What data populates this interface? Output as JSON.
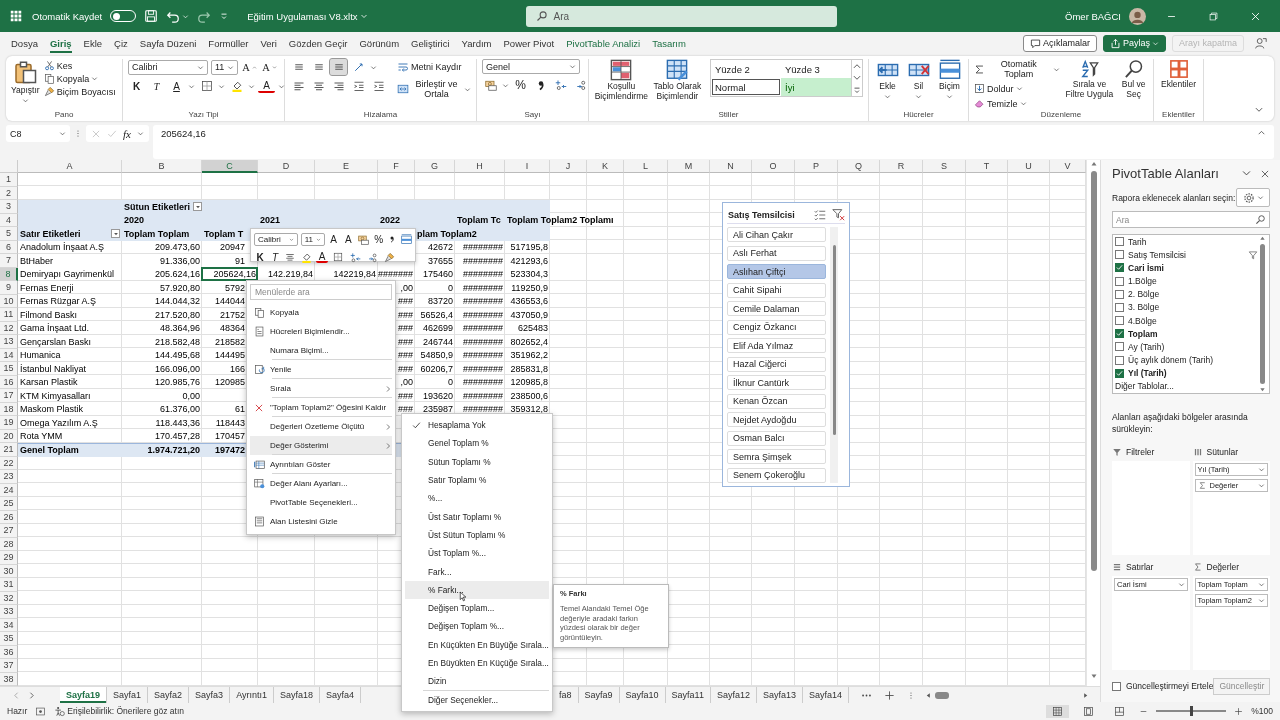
{
  "title_bar": {
    "autosave_label": "Otomatik Kaydet",
    "autosave_on": false,
    "file_name": "Eğitim Uygulaması V8.xltx",
    "search_placeholder": "Ara",
    "user_name": "Ömer BAĞCI"
  },
  "ribbon_tabs": [
    {
      "label": "Dosya",
      "selected": false,
      "kind": "normal"
    },
    {
      "label": "Giriş",
      "selected": true,
      "kind": "normal"
    },
    {
      "label": "Ekle",
      "selected": false,
      "kind": "normal"
    },
    {
      "label": "Çiz",
      "selected": false,
      "kind": "normal"
    },
    {
      "label": "Sayfa Düzeni",
      "selected": false,
      "kind": "normal"
    },
    {
      "label": "Formüller",
      "selected": false,
      "kind": "normal"
    },
    {
      "label": "Veri",
      "selected": false,
      "kind": "normal"
    },
    {
      "label": "Gözden Geçir",
      "selected": false,
      "kind": "normal"
    },
    {
      "label": "Görünüm",
      "selected": false,
      "kind": "normal"
    },
    {
      "label": "Geliştirici",
      "selected": false,
      "kind": "normal"
    },
    {
      "label": "Yardım",
      "selected": false,
      "kind": "normal"
    },
    {
      "label": "Power Pivot",
      "selected": false,
      "kind": "normal"
    },
    {
      "label": "PivotTable Analizi",
      "selected": false,
      "kind": "context"
    },
    {
      "label": "Tasarım",
      "selected": false,
      "kind": "context"
    }
  ],
  "ribbon_actions": {
    "comments": "Açıklamalar",
    "share": "Paylaş",
    "end_call": {
      "label": "Arayı kapatma",
      "disabled": true
    }
  },
  "ribbon": {
    "clipboard": {
      "paste": "Yapıştır",
      "cut": "Kes",
      "copy": "Kopyala",
      "format_painter": "Biçim Boyacısı",
      "label": "Pano"
    },
    "font": {
      "name": "Calibri",
      "size": "11",
      "grow": "A",
      "shrink": "A",
      "bold": "K",
      "italic": "T",
      "underline": "A",
      "font_color": "A",
      "label": "Yazı Tipi"
    },
    "alignment": {
      "vertical_align": [
        {
          "selected": false
        },
        {
          "selected": false
        },
        {
          "selected": true
        }
      ],
      "wrap": "Metni Kaydır",
      "merge": "Birleştir ve Ortala",
      "label": "Hizalama"
    },
    "number": {
      "format": "Genel",
      "percent": "%",
      "label": "Sayı"
    },
    "styles": {
      "conditional": "Koşullu Biçimlendirme",
      "table": "Tablo Olarak Biçimlendir",
      "gallery": [
        {
          "label": "Yüzde 2",
          "kind": "plain"
        },
        {
          "label": "Yüzde 3",
          "kind": "plain"
        },
        {
          "label": "Normal",
          "kind": "normal"
        },
        {
          "label": "İyi",
          "kind": "good"
        }
      ],
      "label": "Stiller"
    },
    "cells": {
      "insert": "Ekle",
      "delete": "Sil",
      "format": "Biçim",
      "label": "Hücreler"
    },
    "editing": {
      "autosum": "Otomatik Toplam",
      "fill": "Doldur",
      "clear": "Temizle",
      "sort": "Sırala ve Filtre Uygula",
      "find": "Bul ve Seç",
      "label": "Düzenleme"
    },
    "addins": {
      "button": "Eklentiler",
      "label": "Eklentiler"
    }
  },
  "formula_bar": {
    "name_box": "C8",
    "fx": "fx",
    "value": "205624,16"
  },
  "sheet": {
    "column_headers": [
      {
        "label": "A",
        "selected": false
      },
      {
        "label": "B",
        "selected": false
      },
      {
        "label": "C",
        "selected": true
      },
      {
        "label": "D",
        "selected": false
      },
      {
        "label": "E",
        "selected": false
      },
      {
        "label": "F",
        "selected": false
      },
      {
        "label": "G",
        "selected": false
      },
      {
        "label": "H",
        "selected": false
      },
      {
        "label": "I",
        "selected": false
      },
      {
        "label": "J",
        "selected": false
      },
      {
        "label": "K",
        "selected": false
      },
      {
        "label": "L",
        "selected": false
      },
      {
        "label": "M",
        "selected": false
      },
      {
        "label": "N",
        "selected": false
      },
      {
        "label": "O",
        "selected": false
      },
      {
        "label": "P",
        "selected": false
      },
      {
        "label": "Q",
        "selected": false
      },
      {
        "label": "R",
        "selected": false
      },
      {
        "label": "S",
        "selected": false
      },
      {
        "label": "T",
        "selected": false
      },
      {
        "label": "U",
        "selected": false
      },
      {
        "label": "V",
        "selected": false
      }
    ],
    "rows": [
      {
        "number": "1",
        "selected": false,
        "kind": "blank"
      },
      {
        "number": "2",
        "selected": false,
        "kind": "blank"
      },
      {
        "number": "3",
        "selected": false,
        "kind": "header",
        "cells": [
          null,
          {
            "text": "Sütun Etiketleri",
            "dropdown": true
          }
        ]
      },
      {
        "number": "4",
        "selected": false,
        "kind": "header",
        "cells": [
          null,
          "2020",
          null,
          "2021",
          null,
          "2022",
          null,
          "Toplam Tc",
          "Toplam Toplam2 Toplamı"
        ]
      },
      {
        "number": "5",
        "selected": false,
        "kind": "header",
        "cells": [
          {
            "text": "Satır Etiketleri",
            "dropdown": true
          },
          "Toplam Toplam",
          "Toplam T",
          null,
          null,
          null,
          "plam Toplam2"
        ]
      },
      {
        "number": "6",
        "selected": false,
        "kind": "data",
        "cells": [
          "Anadolum İnşaat A.Ş",
          "209.473,60",
          "20947",
          null,
          null,
          null,
          "42672",
          "########",
          "517195,8"
        ]
      },
      {
        "number": "7",
        "selected": false,
        "kind": "data",
        "cells": [
          "BtHaber",
          "91.336,00",
          "91",
          null,
          null,
          null,
          "37655",
          "########",
          "421293,6"
        ]
      },
      {
        "number": "8",
        "selected": true,
        "kind": "data",
        "cells": [
          "Demiryapı Gayrimenkül",
          "205.624,16",
          {
            "text": "205624,16",
            "selected": true
          },
          "142.219,84",
          "142219,84",
          "#######",
          "175460",
          "########",
          "523304,3"
        ]
      },
      {
        "number": "9",
        "selected": false,
        "kind": "data",
        "cells": [
          "Fernas Enerji",
          "57.920,80",
          "5792",
          null,
          null,
          ",00",
          "0",
          "########",
          "119250,9"
        ]
      },
      {
        "number": "10",
        "selected": false,
        "kind": "data",
        "cells": [
          "Fernas Rüzgar A.Ş",
          "144.044,32",
          "144044",
          null,
          null,
          "###",
          "83720",
          "########",
          "436553,6"
        ]
      },
      {
        "number": "11",
        "selected": false,
        "kind": "data",
        "cells": [
          "Filmond Baskı",
          "217.520,80",
          "21752",
          null,
          null,
          "###",
          "56526,4",
          "########",
          "437050,9"
        ]
      },
      {
        "number": "12",
        "selected": false,
        "kind": "data",
        "cells": [
          "Gama İnşaat Ltd.",
          "48.364,96",
          "48364",
          null,
          null,
          "###",
          "462699",
          "########",
          "625483"
        ]
      },
      {
        "number": "13",
        "selected": false,
        "kind": "data",
        "cells": [
          "Gençarslan Baskı",
          "218.582,48",
          "218582",
          null,
          null,
          "###",
          "246744",
          "########",
          "802652,4"
        ]
      },
      {
        "number": "14",
        "selected": false,
        "kind": "data",
        "cells": [
          "Humanica",
          "144.495,68",
          "144495",
          null,
          null,
          "###",
          "54850,9",
          "########",
          "351962,2"
        ]
      },
      {
        "number": "15",
        "selected": false,
        "kind": "data",
        "cells": [
          "İstanbul Nakliyat",
          "166.096,00",
          "166",
          null,
          null,
          "###",
          "60206,7",
          "########",
          "285831,8"
        ]
      },
      {
        "number": "16",
        "selected": false,
        "kind": "data",
        "cells": [
          "Karsan Plastik",
          "120.985,76",
          "120985",
          null,
          null,
          ",00",
          "0",
          "########",
          "120985,8"
        ]
      },
      {
        "number": "17",
        "selected": false,
        "kind": "data",
        "cells": [
          "KTM Kimyasalları",
          "0,00",
          null,
          null,
          null,
          "###",
          "193620",
          "########",
          "238500,6"
        ]
      },
      {
        "number": "18",
        "selected": false,
        "kind": "data",
        "cells": [
          "Maskom Plastik",
          "61.376,00",
          "61",
          null,
          null,
          "###",
          "235987",
          "########",
          "359312,8"
        ]
      },
      {
        "number": "19",
        "selected": false,
        "kind": "data",
        "cells": [
          "Omega Yazılım A.Ş",
          "118.443,36",
          "118443"
        ]
      },
      {
        "number": "20",
        "selected": false,
        "kind": "data",
        "cells": [
          "Rota YMM",
          "170.457,28",
          "170457"
        ]
      },
      {
        "number": "21",
        "selected": false,
        "kind": "total",
        "cells": [
          "Genel Toplam",
          "1.974.721,20",
          "197472"
        ]
      },
      {
        "number": "22",
        "selected": false,
        "kind": "blank"
      },
      {
        "number": "23",
        "selected": false,
        "kind": "blank"
      },
      {
        "number": "24",
        "selected": false,
        "kind": "blank"
      },
      {
        "number": "25",
        "selected": false,
        "kind": "blank"
      },
      {
        "number": "26",
        "selected": false,
        "kind": "blank"
      },
      {
        "number": "27",
        "selected": false,
        "kind": "blank"
      },
      {
        "number": "28",
        "selected": false,
        "kind": "blank"
      },
      {
        "number": "29",
        "selected": false,
        "kind": "blank"
      },
      {
        "number": "30",
        "selected": false,
        "kind": "blank"
      },
      {
        "number": "31",
        "selected": false,
        "kind": "blank"
      },
      {
        "number": "32",
        "selected": false,
        "kind": "blank"
      },
      {
        "number": "33",
        "selected": false,
        "kind": "blank"
      },
      {
        "number": "34",
        "selected": false,
        "kind": "blank"
      },
      {
        "number": "35",
        "selected": false,
        "kind": "blank"
      },
      {
        "number": "36",
        "selected": false,
        "kind": "blank"
      },
      {
        "number": "37",
        "selected": false,
        "kind": "blank"
      },
      {
        "number": "38",
        "selected": false,
        "kind": "blank"
      }
    ]
  },
  "mini_toolbar": {
    "font": "Calibri",
    "size": "11",
    "grow": "A",
    "shrink": "A",
    "percent": "%",
    "bold": "K",
    "italic": "T",
    "font_color": "A"
  },
  "context_menu": {
    "search_placeholder": "Menülerde ara",
    "items": [
      {
        "label": "Kopyala",
        "kind": "copy",
        "submenu": false,
        "selected": false,
        "separator_after": false
      },
      {
        "label": "Hücreleri Biçimlendir...",
        "kind": "format",
        "submenu": false,
        "selected": false,
        "separator_after": false
      },
      {
        "label": "Numara Biçimi...",
        "kind": "plain",
        "submenu": false,
        "selected": false,
        "separator_after": true
      },
      {
        "label": "Yenile",
        "kind": "refresh",
        "submenu": false,
        "selected": false,
        "separator_after": true
      },
      {
        "label": "Sırala",
        "kind": "plain",
        "submenu": true,
        "selected": false,
        "separator_after": true
      },
      {
        "label": "\"Toplam Toplam2\" Öğesini Kaldır",
        "kind": "remove",
        "submenu": false,
        "selected": false,
        "separator_after": true
      },
      {
        "label": "Değerleri Özetleme Ölçütü",
        "kind": "plain",
        "submenu": true,
        "selected": false,
        "separator_after": false
      },
      {
        "label": "Değer Gösterimi",
        "kind": "plain",
        "submenu": true,
        "selected": true,
        "separator_after": true
      },
      {
        "label": "Ayrıntıları Göster",
        "kind": "details",
        "submenu": false,
        "selected": false,
        "separator_after": true
      },
      {
        "label": "Değer Alanı Ayarları...",
        "kind": "settings",
        "submenu": false,
        "selected": false,
        "separator_after": false
      },
      {
        "label": "PivotTable Seçenekleri...",
        "kind": "plain",
        "submenu": false,
        "selected": false,
        "separator_after": false
      },
      {
        "label": "Alan Listesini Gizle",
        "kind": "list",
        "submenu": false,
        "selected": false,
        "separator_after": false
      }
    ]
  },
  "submenu": {
    "items": [
      {
        "label": "Hesaplama Yok",
        "checked": true,
        "selected": false,
        "separator_before": false
      },
      {
        "label": "Genel Toplam %",
        "checked": false,
        "selected": false,
        "separator_before": false
      },
      {
        "label": "Sütun Toplamı %",
        "checked": false,
        "selected": false,
        "separator_before": false
      },
      {
        "label": "Satır Toplamı %",
        "checked": false,
        "selected": false,
        "separator_before": false
      },
      {
        "label": "%...",
        "checked": false,
        "selected": false,
        "separator_before": false
      },
      {
        "label": "Üst Satır Toplamı %",
        "checked": false,
        "selected": false,
        "separator_before": false
      },
      {
        "label": "Üst Sütun Toplamı %",
        "checked": false,
        "selected": false,
        "separator_before": false
      },
      {
        "label": "Üst Toplam %...",
        "checked": false,
        "selected": false,
        "separator_before": false
      },
      {
        "label": "Fark...",
        "checked": false,
        "selected": false,
        "separator_before": false
      },
      {
        "label": "% Farkı...",
        "checked": false,
        "selected": true,
        "separator_before": false
      },
      {
        "label": "Değişen Toplam...",
        "checked": false,
        "selected": false,
        "separator_before": false
      },
      {
        "label": "Değişen Toplam %...",
        "checked": false,
        "selected": false,
        "separator_before": false
      },
      {
        "label": "En Küçükten En Büyüğe Sırala...",
        "checked": false,
        "selected": false,
        "separator_before": false
      },
      {
        "label": "En Büyükten En Küçüğe Sırala...",
        "checked": false,
        "selected": false,
        "separator_before": false
      },
      {
        "label": "Dizin",
        "checked": false,
        "selected": false,
        "separator_before": false
      },
      {
        "label": "Diğer Seçenekler...",
        "checked": false,
        "selected": false,
        "separator_before": true
      }
    ]
  },
  "tooltip": {
    "title": "% Farkı",
    "text": "Temel Alandaki Temel Öğe değeriyle aradaki farkın yüzdesi olarak bir değer görüntüleyin."
  },
  "slicer": {
    "title": "Satış Temsilcisi",
    "items": [
      {
        "label": "Ali Cihan Çakır",
        "selected": false
      },
      {
        "label": "Aslı Ferhat",
        "selected": false
      },
      {
        "label": "Aslıhan Çiftçi",
        "selected": true
      },
      {
        "label": "Cahit Sipahi",
        "selected": false
      },
      {
        "label": "Cemile Dalaman",
        "selected": false
      },
      {
        "label": "Cengiz Özkancı",
        "selected": false
      },
      {
        "label": "Elif Ada Yılmaz",
        "selected": false
      },
      {
        "label": "Hazal Ciğerci",
        "selected": false
      },
      {
        "label": "İlknur Cantürk",
        "selected": false
      },
      {
        "label": "Kenan Özcan",
        "selected": false
      },
      {
        "label": "Nejdet Aydoğdu",
        "selected": false
      },
      {
        "label": "Osman Balcı",
        "selected": false
      },
      {
        "label": "Semra Şimşek",
        "selected": false
      },
      {
        "label": "Senem Çokeroğlu",
        "selected": false
      }
    ]
  },
  "pivot_pane": {
    "title": "PivotTable Alanları",
    "prompt": "Rapora eklenecek alanları seçin:",
    "search_placeholder": "Ara",
    "fields": [
      {
        "label": "Tarih",
        "checked": false,
        "filtered": false
      },
      {
        "label": "Satış Temsilcisi",
        "checked": false,
        "filtered": true
      },
      {
        "label": "Cari İsmi",
        "checked": true,
        "filtered": false
      },
      {
        "label": "1.Bölge",
        "checked": false,
        "filtered": false
      },
      {
        "label": "2. Bölge",
        "checked": false,
        "filtered": false
      },
      {
        "label": "3. Bölge",
        "checked": false,
        "filtered": false
      },
      {
        "label": "4.Bölge",
        "checked": false,
        "filtered": false
      },
      {
        "label": "Toplam",
        "checked": true,
        "filtered": false
      },
      {
        "label": "Ay (Tarih)",
        "checked": false,
        "filtered": false
      },
      {
        "label": "Üç aylık dönem (Tarih)",
        "checked": false,
        "filtered": false
      },
      {
        "label": "Yıl (Tarih)",
        "checked": true,
        "filtered": false
      }
    ],
    "more_tables": "Diğer Tablolar...",
    "drag_hint": "Alanları aşağıdaki bölgeler arasında sürükleyin:",
    "areas": [
      {
        "label": "Filtreler",
        "kind": "filters"
      },
      {
        "label": "Sütunlar",
        "kind": "columns",
        "items": [
          {
            "label": "Yıl (Tarih)",
            "kind": "field"
          },
          {
            "label": "Değerler",
            "kind": "values"
          }
        ]
      },
      {
        "label": "Satırlar",
        "kind": "rows",
        "items": [
          {
            "label": "Cari İsmi",
            "kind": "field"
          }
        ]
      },
      {
        "label": "Değerler",
        "kind": "values",
        "items": [
          {
            "label": "Toplam Toplam",
            "kind": "field"
          },
          {
            "label": "Toplam Toplam2",
            "kind": "field"
          }
        ]
      }
    ],
    "defer": {
      "label": "Güncelleştirmeyi Ertele",
      "checked": false
    },
    "update_button": {
      "label": "Güncelleştir",
      "disabled": true
    }
  },
  "sheet_tabs": {
    "left": [
      {
        "label": "Sayfa19",
        "selected": true
      },
      {
        "label": "Sayfa1",
        "selected": false
      },
      {
        "label": "Sayfa2",
        "selected": false
      },
      {
        "label": "Sayfa3",
        "selected": false
      },
      {
        "label": "Ayrıntı1",
        "selected": false
      },
      {
        "label": "Sayfa18",
        "selected": false
      },
      {
        "label": "Sayfa4",
        "selected": false
      }
    ],
    "right": [
      {
        "label": "fa8",
        "selected": false
      },
      {
        "label": "Sayfa9",
        "selected": false
      },
      {
        "label": "Sayfa10",
        "selected": false
      },
      {
        "label": "Sayfa11",
        "selected": false
      },
      {
        "label": "Sayfa12",
        "selected": false
      },
      {
        "label": "Sayfa13",
        "selected": false
      },
      {
        "label": "Sayfa14",
        "selected": false
      }
    ]
  },
  "status_bar": {
    "ready": "Hazır",
    "accessibility": "Erişilebilirlik: Önerilere göz atın",
    "zoom_slider": {
      "level": 0.5
    },
    "zoom": "%100"
  }
}
